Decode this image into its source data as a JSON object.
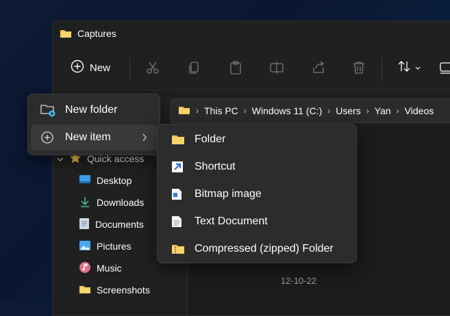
{
  "window": {
    "title": "Captures"
  },
  "toolbar": {
    "new_label": "New",
    "icons": [
      "cut-icon",
      "copy-icon",
      "paste-icon",
      "rename-icon",
      "share-icon",
      "delete-icon",
      "sort-icon",
      "view-icon"
    ]
  },
  "address": {
    "crumbs": [
      "This PC",
      "Windows 11 (C:)",
      "Users",
      "Yan",
      "Videos"
    ]
  },
  "nav": {
    "quick_access": "Quick access",
    "items": [
      "Desktop",
      "Downloads",
      "Documents",
      "Pictures",
      "Music",
      "Screenshots"
    ]
  },
  "content": {
    "date_peek": "12-10-22"
  },
  "new_menu": {
    "items": [
      {
        "label": "New folder"
      },
      {
        "label": "New item"
      }
    ]
  },
  "submenu": {
    "items": [
      {
        "label": "Folder",
        "icon": "folder-icon"
      },
      {
        "label": "Shortcut",
        "icon": "shortcut-icon"
      },
      {
        "label": "Bitmap image",
        "icon": "bitmap-icon"
      },
      {
        "label": "Text Document",
        "icon": "text-document-icon"
      },
      {
        "label": "Compressed (zipped) Folder",
        "icon": "zip-folder-icon"
      }
    ]
  },
  "colors": {
    "folder": "#f2c14e",
    "accent": "#4cc2ff",
    "menu_bg": "#2c2c2c",
    "highlight": "#3a3a3a"
  }
}
